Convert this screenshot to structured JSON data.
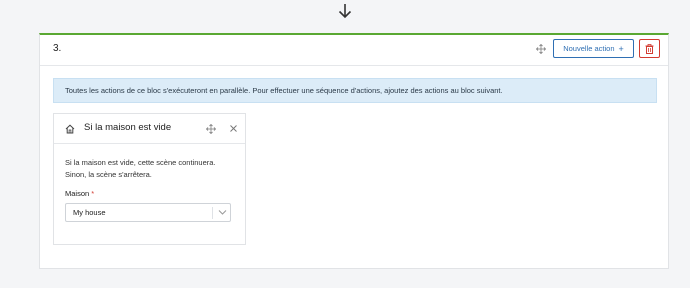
{
  "block": {
    "number": "3.",
    "new_action_label": "Nouvelle action",
    "new_action_plus": "+",
    "info_text": "Toutes les actions de ce bloc s'exécuteront en parallèle. Pour effectuer une séquence d'actions, ajoutez des actions au bloc suivant."
  },
  "condition": {
    "title": "Si la maison est vide",
    "description_line1": "Si la maison est vide, cette scène continuera.",
    "description_line2": "Sinon, la scène s'arrêtera.",
    "field_label": "Maison",
    "required_mark": "*",
    "select_value": "My house"
  },
  "icons": {
    "arrow": "arrow-down-icon",
    "move": "move-icon",
    "trash": "trash-icon",
    "home": "home-icon",
    "close": "close-icon",
    "chevron": "chevron-down-icon"
  },
  "colors": {
    "accent_green": "#5aa832",
    "primary_blue": "#2f6fb3",
    "danger_red": "#d33b30",
    "info_bg": "#dcecf8"
  }
}
